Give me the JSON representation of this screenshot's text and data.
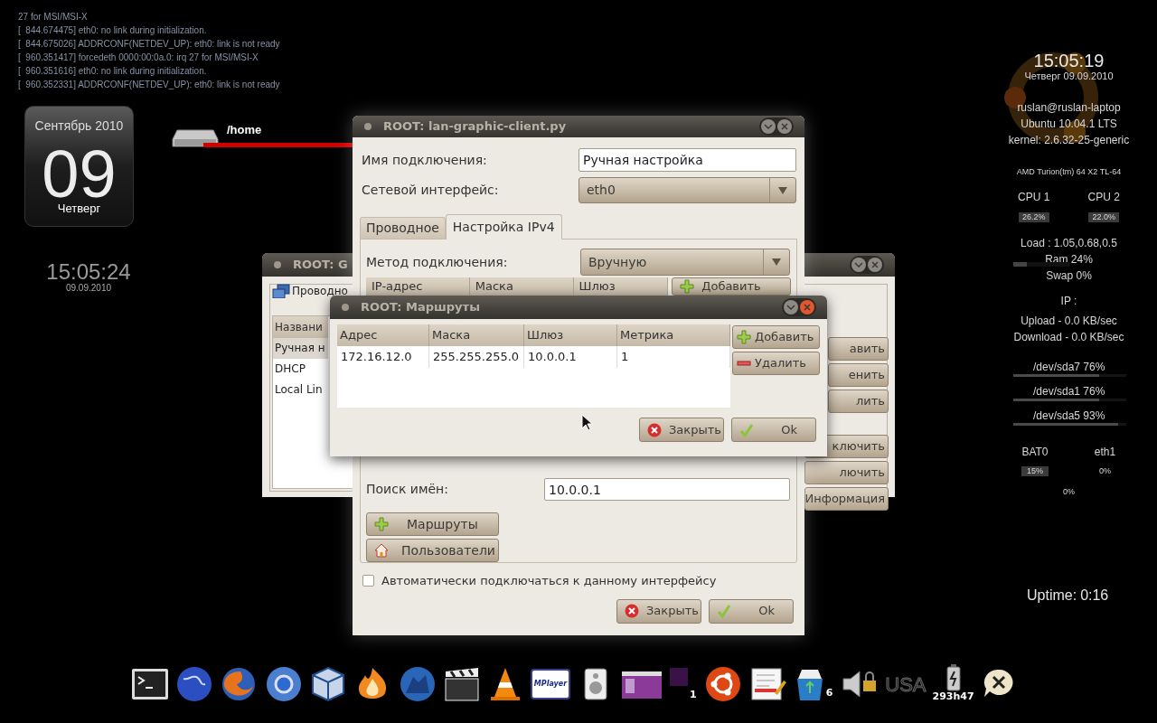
{
  "log_lines": [
    "27 for MSI/MSI-X",
    "[  844.674475] eth0: no link during initialization.",
    "[  844.675026] ADDRCONF(NETDEV_UP): eth0: link is not ready",
    "[  960.351417] forcedeth 0000:00:0a.0: irq 27 for MSI/MSI-X",
    "[  960.351616] eth0: no link during initialization.",
    "[  960.352331] ADDRCONF(NETDEV_UP): eth0: link is not ready"
  ],
  "calendar": {
    "month": "Сентябрь 2010",
    "day": "09",
    "weekday": "Четверг"
  },
  "clock": {
    "time": "15:05:24",
    "date": "09.09.2010"
  },
  "drive": {
    "mount": "/home"
  },
  "system_monitor": {
    "time": "15:05:19",
    "date": "Четверг 09.09.2010",
    "user": "ruslan@ruslan-laptop",
    "os": "Ubuntu 10.04.1 LTS",
    "kernel": "kernel: 2.6.32-25-generic",
    "cpu_model": "AMD Turion(tm) 64 X2 TL-64",
    "cpus": [
      {
        "name": "CPU 1",
        "reading": "26.2%"
      },
      {
        "name": "CPU 2",
        "reading": "22.0%"
      }
    ],
    "load": "Load : 1.05,0.68,0.5",
    "ram": {
      "reading": "Ram 24%",
      "level": 0.24
    },
    "swap": "Swap 0%",
    "ip": "IP :",
    "upload": "Upload - 0.0 KB/sec",
    "download": "Download - 0.0 KB/sec",
    "disks": [
      {
        "reading": "/dev/sda7 76%",
        "level": 0.76
      },
      {
        "reading": "/dev/sda1 76%",
        "level": 0.76
      },
      {
        "reading": "/dev/sda5 93%",
        "level": 0.93
      }
    ],
    "battery": {
      "name": "BAT0",
      "reading": "15%"
    },
    "network": {
      "name": "eth1",
      "reading": "0%"
    },
    "extra_reading": "0%",
    "uptime_label": "Uptime:",
    "uptime": "0:16"
  },
  "background_window": {
    "title": "ROOT: G",
    "tab": "Проводно",
    "list_header": "Названи",
    "list_items": [
      {
        "label": "Ручная н",
        "selected": true
      },
      {
        "label": "DHCP",
        "selected": false
      },
      {
        "label": "Local Lin",
        "selected": false
      }
    ],
    "buttons": [
      "авить",
      "енить",
      "лить",
      "ключить",
      "лючить",
      "Информация"
    ]
  },
  "main_window": {
    "title": "ROOT: lan-graphic-client.py",
    "connection_name": {
      "label": "Имя подключения:",
      "value": "Ручная настройка"
    },
    "interface": {
      "label": "Сетевой интерфейс:",
      "value": "eth0"
    },
    "tabs": [
      {
        "label": "Проводное",
        "selected": false
      },
      {
        "label": "Настройка IPv4",
        "selected": true
      }
    ],
    "method": {
      "label": "Метод подключения:",
      "value": "Вручную"
    },
    "address_table": {
      "columns": [
        "IP-адрес",
        "Маска",
        "Шлюз"
      ],
      "add_button": "Добавить"
    },
    "dns_search": {
      "label": "Поиск имён:",
      "value": "10.0.0.1"
    },
    "routes_button": "Маршруты",
    "users_button": "Пользователи",
    "auto_connect": {
      "label": "Автоматически подключаться к данному интерфейсу",
      "checked": false
    },
    "buttons": [
      {
        "kind": "close",
        "label": "Закрыть"
      },
      {
        "kind": "ok",
        "label": "Ok"
      }
    ]
  },
  "routes_dialog": {
    "title": "ROOT: Маршруты",
    "columns": [
      "Адрес",
      "Маска",
      "Шлюз",
      "Метрика"
    ],
    "rows": [
      [
        "172.16.12.0",
        "255.255.255.0",
        "10.0.0.1",
        "1"
      ]
    ],
    "side_buttons": [
      {
        "kind": "add",
        "label": "Добавить"
      },
      {
        "kind": "remove",
        "label": "Удалить"
      }
    ],
    "buttons": [
      {
        "kind": "close",
        "label": "Закрыть"
      },
      {
        "kind": "ok",
        "label": "Ok"
      }
    ]
  },
  "dock": {
    "player_logo": "MPlayer",
    "workspace": "1",
    "trash_count": "6",
    "keyboard_layout": "USA",
    "battery_time": "293h47"
  }
}
